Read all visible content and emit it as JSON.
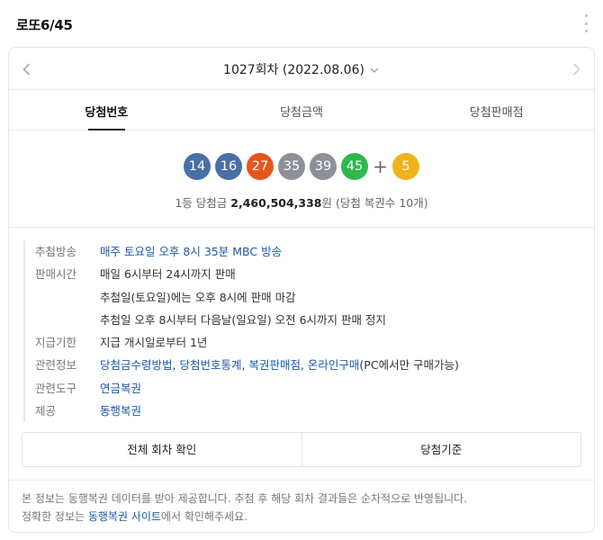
{
  "header": {
    "title": "로또6/45"
  },
  "round": {
    "label": "1027회차 (2022.08.06)"
  },
  "tabs": [
    {
      "label": "당첨번호",
      "active": true
    },
    {
      "label": "당첨금액",
      "active": false
    },
    {
      "label": "당첨판매점",
      "active": false
    }
  ],
  "numbers": [
    {
      "value": "14",
      "color": "#4a6fa5"
    },
    {
      "value": "16",
      "color": "#4a6fa5"
    },
    {
      "value": "27",
      "color": "#e4561c"
    },
    {
      "value": "35",
      "color": "#8e9098"
    },
    {
      "value": "39",
      "color": "#8e9098"
    },
    {
      "value": "45",
      "color": "#2eb84d"
    }
  ],
  "plus": "+",
  "bonus": {
    "value": "5",
    "color": "#f0b31a"
  },
  "prize": {
    "prefix": "1등 당첨금 ",
    "amount": "2,460,504,338",
    "suffix": "원 (당첨 복권수 10개)"
  },
  "info": {
    "broadcast": {
      "label": "추첨방송",
      "value": "매주 토요일 오후 8시 35분 MBC 방송"
    },
    "sales": {
      "label": "판매시간",
      "lines": [
        "매일 6시부터 24시까지 판매",
        "추첨일(토요일)에는 오후 8시에 판매 마감",
        "추첨일 오후 8시부터 다음날(일요일) 오전 6시까지 판매 정지"
      ]
    },
    "payment": {
      "label": "지급기한",
      "value": "지급 개시일로부터 1년"
    },
    "related": {
      "label": "관련정보",
      "links": [
        "당첨금수령방법",
        "당첨번호통계",
        "복권판매점",
        "온라인구매"
      ],
      "sep": ", ",
      "note": "(PC에서만 구매가능)"
    },
    "tools": {
      "label": "관련도구",
      "value": "연금복권"
    },
    "provider": {
      "label": "제공",
      "value": "동행복권"
    }
  },
  "buttons": {
    "all_rounds": "전체 회차 확인",
    "criteria": "당첨기준"
  },
  "footer": {
    "line1": "본 정보는 동행복권 데이터를 받아 제공합니다. 추첨 후 해당 회차 결과들은 순차적으로 반영됩니다.",
    "line2_prefix": "정확한 정보는 ",
    "line2_link": "동행복권 사이트",
    "line2_suffix": "에서 확인해주세요."
  },
  "colors": {
    "link": "#1a5aa6",
    "border": "#e3e6ea"
  },
  "icons": {
    "prev": "chevron-left-icon",
    "next": "chevron-right-icon",
    "dropdown": "chevron-down-icon",
    "more": "more-vertical-icon"
  }
}
